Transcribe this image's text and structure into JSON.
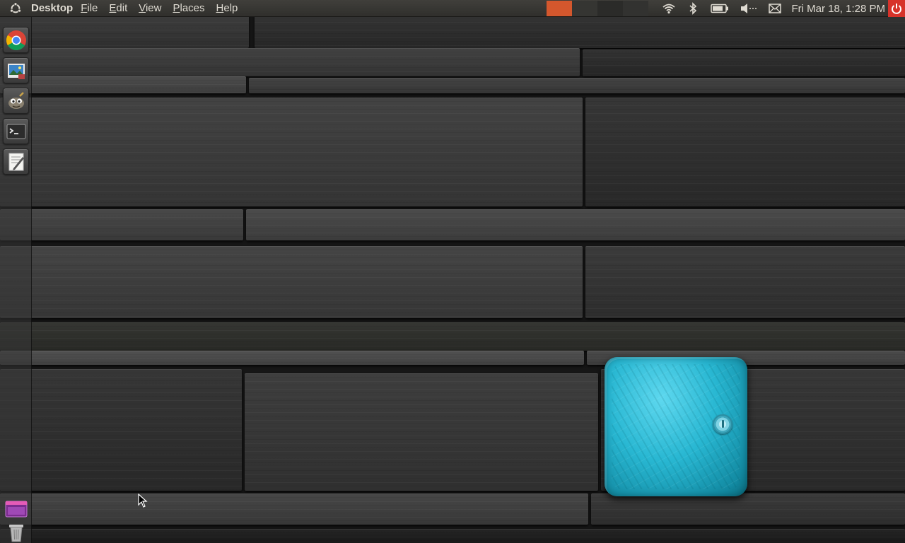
{
  "panel": {
    "app_name": "Desktop",
    "menus": [
      "File",
      "Edit",
      "View",
      "Places",
      "Help"
    ],
    "clock": "Fri Mar 18,  1:28 PM",
    "workspace_colors": [
      "#d4572d",
      "#323230",
      "#2a2a28",
      "#30302e"
    ],
    "indicators": [
      "wifi-icon",
      "bluetooth-icon",
      "battery-icon",
      "volume-icon",
      "mail-icon"
    ],
    "power_color": "#d7322a",
    "logo_icon": "ubuntu-logo-icon"
  },
  "launcher": {
    "apps": [
      {
        "name": "Google Chrome",
        "icon": "chrome-icon"
      },
      {
        "name": "Image Viewer",
        "icon": "image-viewer-icon"
      },
      {
        "name": "GIMP",
        "icon": "gimp-icon"
      },
      {
        "name": "Terminal",
        "icon": "terminal-icon"
      },
      {
        "name": "Text Editor",
        "icon": "text-editor-icon"
      }
    ],
    "bottom": [
      {
        "name": "Workspace Switcher",
        "icon": "workspace-switcher-icon"
      },
      {
        "name": "Trash",
        "icon": "trash-icon"
      }
    ]
  },
  "desktop": {
    "wallpaper": "dark wooden planks",
    "accent_box_color": "#28b7d2"
  }
}
